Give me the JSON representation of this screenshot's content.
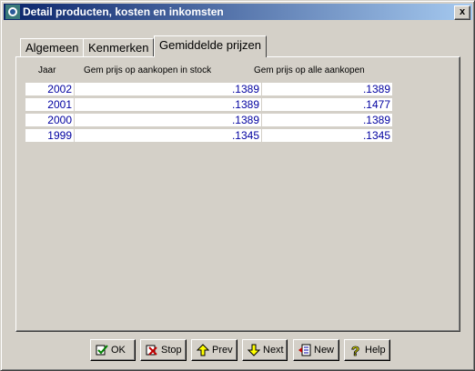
{
  "window": {
    "title": "Detail producten, kosten en inkomsten",
    "close_label": "x"
  },
  "tabs": [
    {
      "label": "Algemeen",
      "active": false
    },
    {
      "label": "Kenmerken",
      "active": false
    },
    {
      "label": "Gemiddelde prijzen",
      "active": true
    }
  ],
  "table": {
    "headers": [
      "Jaar",
      "Gem prijs op aankopen in stock",
      "Gem prijs op alle aankopen"
    ],
    "rows": [
      [
        "2002",
        ".1389",
        ".1389"
      ],
      [
        "2001",
        ".1389",
        ".1477"
      ],
      [
        "2000",
        ".1389",
        ".1389"
      ],
      [
        "1999",
        ".1345",
        ".1345"
      ]
    ]
  },
  "buttons": {
    "ok": "OK",
    "stop": "Stop",
    "prev": "Prev",
    "next": "Next",
    "new": "New",
    "help": "Help"
  },
  "colors": {
    "title_gradient_start": "#0a246a",
    "title_gradient_end": "#a6caf0",
    "value_text": "#0000a0",
    "face": "#d4d0c8"
  }
}
